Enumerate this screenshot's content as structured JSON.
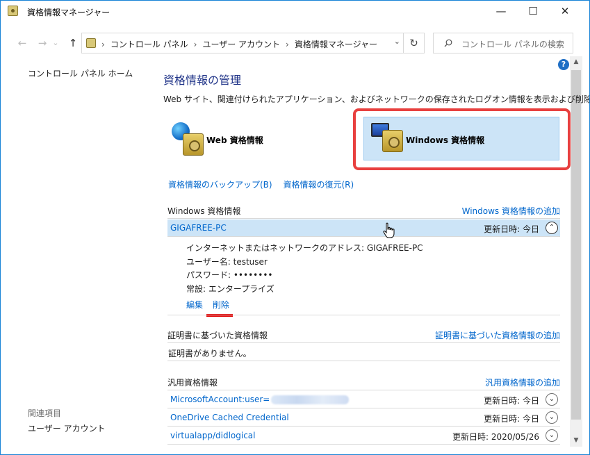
{
  "window": {
    "title": "資格情報マネージャー",
    "minimize": "—",
    "maximize": "☐",
    "close": "✕"
  },
  "nav": {
    "back": "←",
    "forward": "→",
    "recent": "⌄",
    "up": "↑",
    "refresh": "↻"
  },
  "address": {
    "crumbs": [
      "コントロール パネル",
      "ユーザー アカウント",
      "資格情報マネージャー"
    ],
    "sep": "›"
  },
  "search": {
    "placeholder": "コントロール パネルの検索"
  },
  "sidebar": {
    "home": "コントロール パネル ホーム",
    "related_title": "関連項目",
    "related_items": [
      "ユーザー アカウント"
    ]
  },
  "main": {
    "title": "資格情報の管理",
    "description": "Web サイト、関連付けられたアプリケーション、およびネットワークの保存されたログオン情報を表示および削除します。",
    "categories": {
      "web": "Web 資格情報",
      "windows": "Windows 資格情報",
      "selected": "windows"
    },
    "backup_link": "資格情報のバックアップ(B)",
    "restore_link": "資格情報の復元(R)"
  },
  "windows_section": {
    "title": "Windows 資格情報",
    "add": "Windows 資格情報の追加",
    "credentials": [
      {
        "name": "GIGAFREE-PC",
        "modified": "更新日時:  今日",
        "expanded": true,
        "details": [
          "インターネットまたはネットワークのアドレス:  GIGAFREE-PC",
          "ユーザー名:  testuser",
          "パスワード:  ••••••••",
          "常設:  エンタープライズ"
        ],
        "edit": "編集",
        "remove": "削除"
      }
    ]
  },
  "cert_section": {
    "title": "証明書に基づいた資格情報",
    "add": "証明書に基づいた資格情報の追加",
    "empty": "証明書がありません。"
  },
  "generic_section": {
    "title": "汎用資格情報",
    "add": "汎用資格情報の追加",
    "credentials": [
      {
        "name": "MicrosoftAccount:user=",
        "modified": "更新日時:  今日"
      },
      {
        "name": "OneDrive Cached Credential",
        "modified": "更新日時:  今日"
      },
      {
        "name": "virtualapp/didlogical",
        "modified": "更新日時:  2020/05/26"
      }
    ]
  },
  "icons": {
    "chevron_up": "⌃",
    "chevron_down": "⌄",
    "help": "?",
    "scroll_up": "▲",
    "scroll_down": "▼"
  },
  "colors": {
    "link": "#0066cc",
    "heading": "#1e3287",
    "selection": "#cce4f7",
    "highlight_frame": "#e8403f",
    "underline_mark": "#e00000"
  }
}
